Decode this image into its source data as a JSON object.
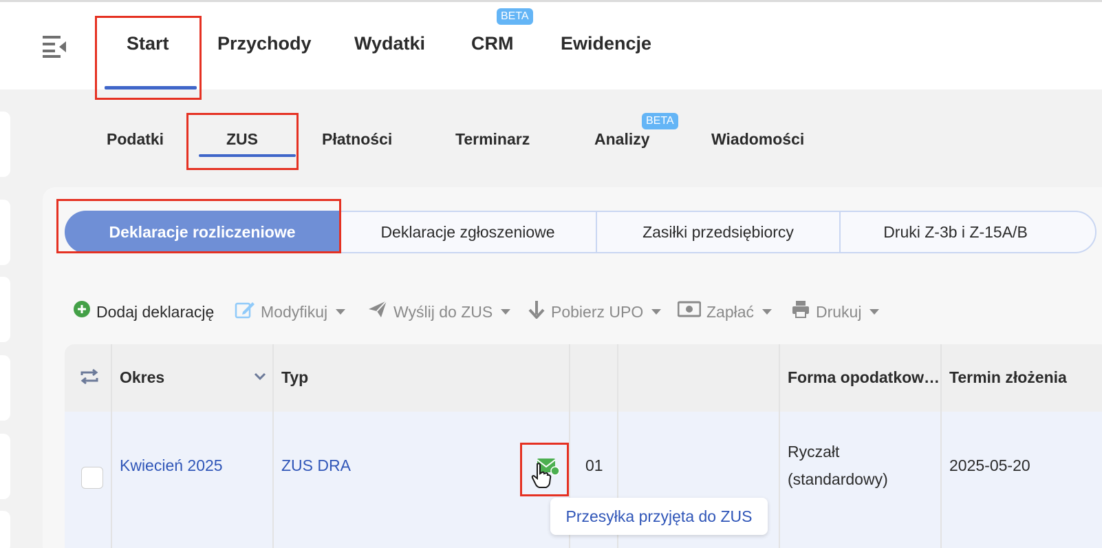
{
  "topnav": {
    "items": [
      "Start",
      "Przychody",
      "Wydatki",
      "CRM",
      "Ewidencje"
    ],
    "beta_label": "BETA"
  },
  "subnav": {
    "items": [
      "Podatki",
      "ZUS",
      "Płatności",
      "Terminarz",
      "Analizy",
      "Wiadomości"
    ],
    "beta_label": "BETA"
  },
  "segments": [
    "Deklaracje rozliczeniowe",
    "Deklaracje zgłoszeniowe",
    "Zasiłki przedsiębiorcy",
    "Druki Z-3b i Z-15A/B"
  ],
  "toolbar": {
    "add": "Dodaj deklarację",
    "modify": "Modyfikuj",
    "send": "Wyślij do ZUS",
    "upo": "Pobierz UPO",
    "pay": "Zapłać",
    "print": "Drukuj"
  },
  "table": {
    "headers": {
      "period": "Okres",
      "type": "Typ",
      "tax_form": "Forma opodatkow…",
      "deadline": "Termin złożenia"
    },
    "row": {
      "period": "Kwiecień 2025",
      "type": "ZUS DRA",
      "number": "01",
      "tax_form_line1": "Ryczałt",
      "tax_form_line2": "(standardowy)",
      "deadline": "2025-05-20"
    }
  },
  "tooltip": "Przesyłka przyjęta do ZUS",
  "colors": {
    "accent": "#3f66c9",
    "active_segment": "#6f8fd6",
    "link": "#3056b8",
    "highlight": "#e53122",
    "status_green": "#4caf50"
  }
}
